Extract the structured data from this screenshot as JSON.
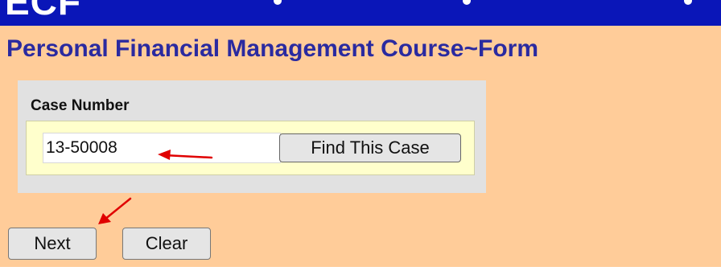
{
  "page": {
    "title": "Personal Financial Management Course~Form"
  },
  "header": {
    "logo_text": "ECF"
  },
  "case_lookup": {
    "label": "Case Number",
    "value": "13-50008",
    "find_button": "Find This Case"
  },
  "actions": {
    "next_label": "Next",
    "clear_label": "Clear"
  },
  "annotations": {
    "arrow_color": "#e00000"
  },
  "colors": {
    "banner": "#0a16b8",
    "page_background": "#ffcc99",
    "title": "#2a2aa0",
    "panel": "#e1e1e1",
    "panel_inner": "#ffffcc"
  }
}
